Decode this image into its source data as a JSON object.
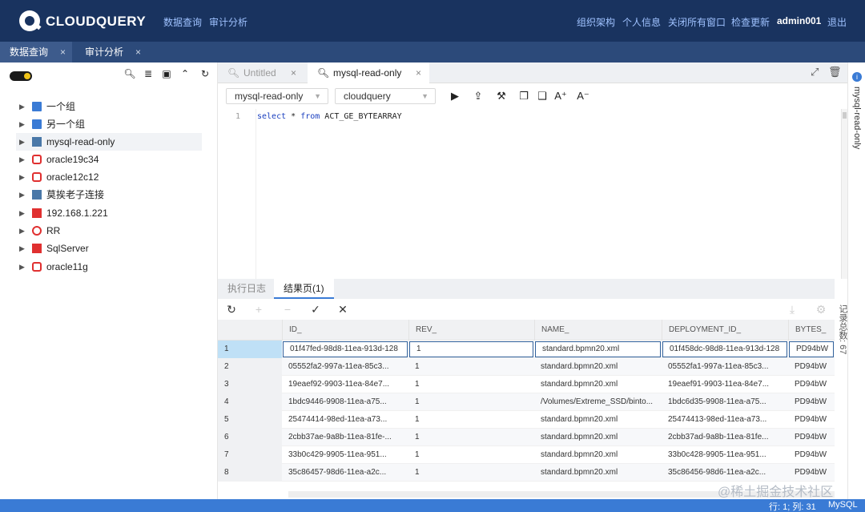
{
  "brand": "CLOUDQUERY",
  "nav": {
    "left": [
      "数据查询",
      "审计分析"
    ],
    "right": [
      "组织架构",
      "个人信息",
      "关闭所有窗口",
      "检查更新"
    ],
    "user": "admin001",
    "logout": "退出"
  },
  "app_tabs": [
    {
      "label": "数据查询",
      "close": "×"
    },
    {
      "label": "审计分析",
      "close": "×"
    }
  ],
  "sidebar": {
    "items": [
      {
        "label": "一个组",
        "icon": "folder-icon"
      },
      {
        "label": "另一个组",
        "icon": "folder-icon"
      },
      {
        "label": "mysql-read-only",
        "icon": "mysql-icon"
      },
      {
        "label": "oracle19c34",
        "icon": "oracle-icon"
      },
      {
        "label": "oracle12c12",
        "icon": "oracle-icon"
      },
      {
        "label": "莫挨老子连接",
        "icon": "mysql-icon"
      },
      {
        "label": "192.168.1.221",
        "icon": "sqlserver-icon"
      },
      {
        "label": "RR",
        "icon": "rr-icon"
      },
      {
        "label": "SqlServer",
        "icon": "sqlserver-icon"
      },
      {
        "label": "oracle11g",
        "icon": "oracle-icon"
      }
    ]
  },
  "query_tabs": [
    {
      "label": "Untitled",
      "close": "×"
    },
    {
      "label": "mysql-read-only",
      "close": "×"
    }
  ],
  "toolbar": {
    "connection": "mysql-read-only",
    "database": "cloudquery"
  },
  "editor": {
    "line": "1",
    "keyword1": "select",
    "star": " * ",
    "keyword2": "from",
    "table": " ACT_GE_BYTEARRAY"
  },
  "result_tabs": [
    "执行日志",
    "结果页(1)"
  ],
  "grid": {
    "columns": [
      "ID_",
      "REV_",
      "NAME_",
      "DEPLOYMENT_ID_",
      "BYTES_"
    ],
    "rows": [
      [
        "1",
        "01f47fed-98d8-11ea-913d-128",
        "1",
        "standard.bpmn20.xml",
        "01f458dc-98d8-11ea-913d-128",
        "PD94bW"
      ],
      [
        "2",
        "05552fa2-997a-11ea-85c3...",
        "1",
        "standard.bpmn20.xml",
        "05552fa1-997a-11ea-85c3...",
        "PD94bW"
      ],
      [
        "3",
        "19eaef92-9903-11ea-84e7...",
        "1",
        "standard.bpmn20.xml",
        "19eaef91-9903-11ea-84e7...",
        "PD94bW"
      ],
      [
        "4",
        "1bdc9446-9908-11ea-a75...",
        "1",
        "/Volumes/Extreme_SSD/binto...",
        "1bdc6d35-9908-11ea-a75...",
        "PD94bW"
      ],
      [
        "5",
        "25474414-98ed-11ea-a73...",
        "1",
        "standard.bpmn20.xml",
        "25474413-98ed-11ea-a73...",
        "PD94bW"
      ],
      [
        "6",
        "2cbb37ae-9a8b-11ea-81fe-...",
        "1",
        "standard.bpmn20.xml",
        "2cbb37ad-9a8b-11ea-81fe...",
        "PD94bW"
      ],
      [
        "7",
        "33b0c429-9905-11ea-951...",
        "1",
        "standard.bpmn20.xml",
        "33b0c428-9905-11ea-951...",
        "PD94bW"
      ],
      [
        "8",
        "35c86457-98d6-11ea-a2c...",
        "1",
        "standard.bpmn20.xml",
        "35c86456-98d6-11ea-a2c...",
        "PD94bW"
      ]
    ]
  },
  "right_rail": "mysql-read-only",
  "record_count": "记录总数: 67",
  "status": {
    "position": "行: 1; 列: 31",
    "dialect": "MySQL"
  },
  "watermark": "@稀土掘金技术社区"
}
